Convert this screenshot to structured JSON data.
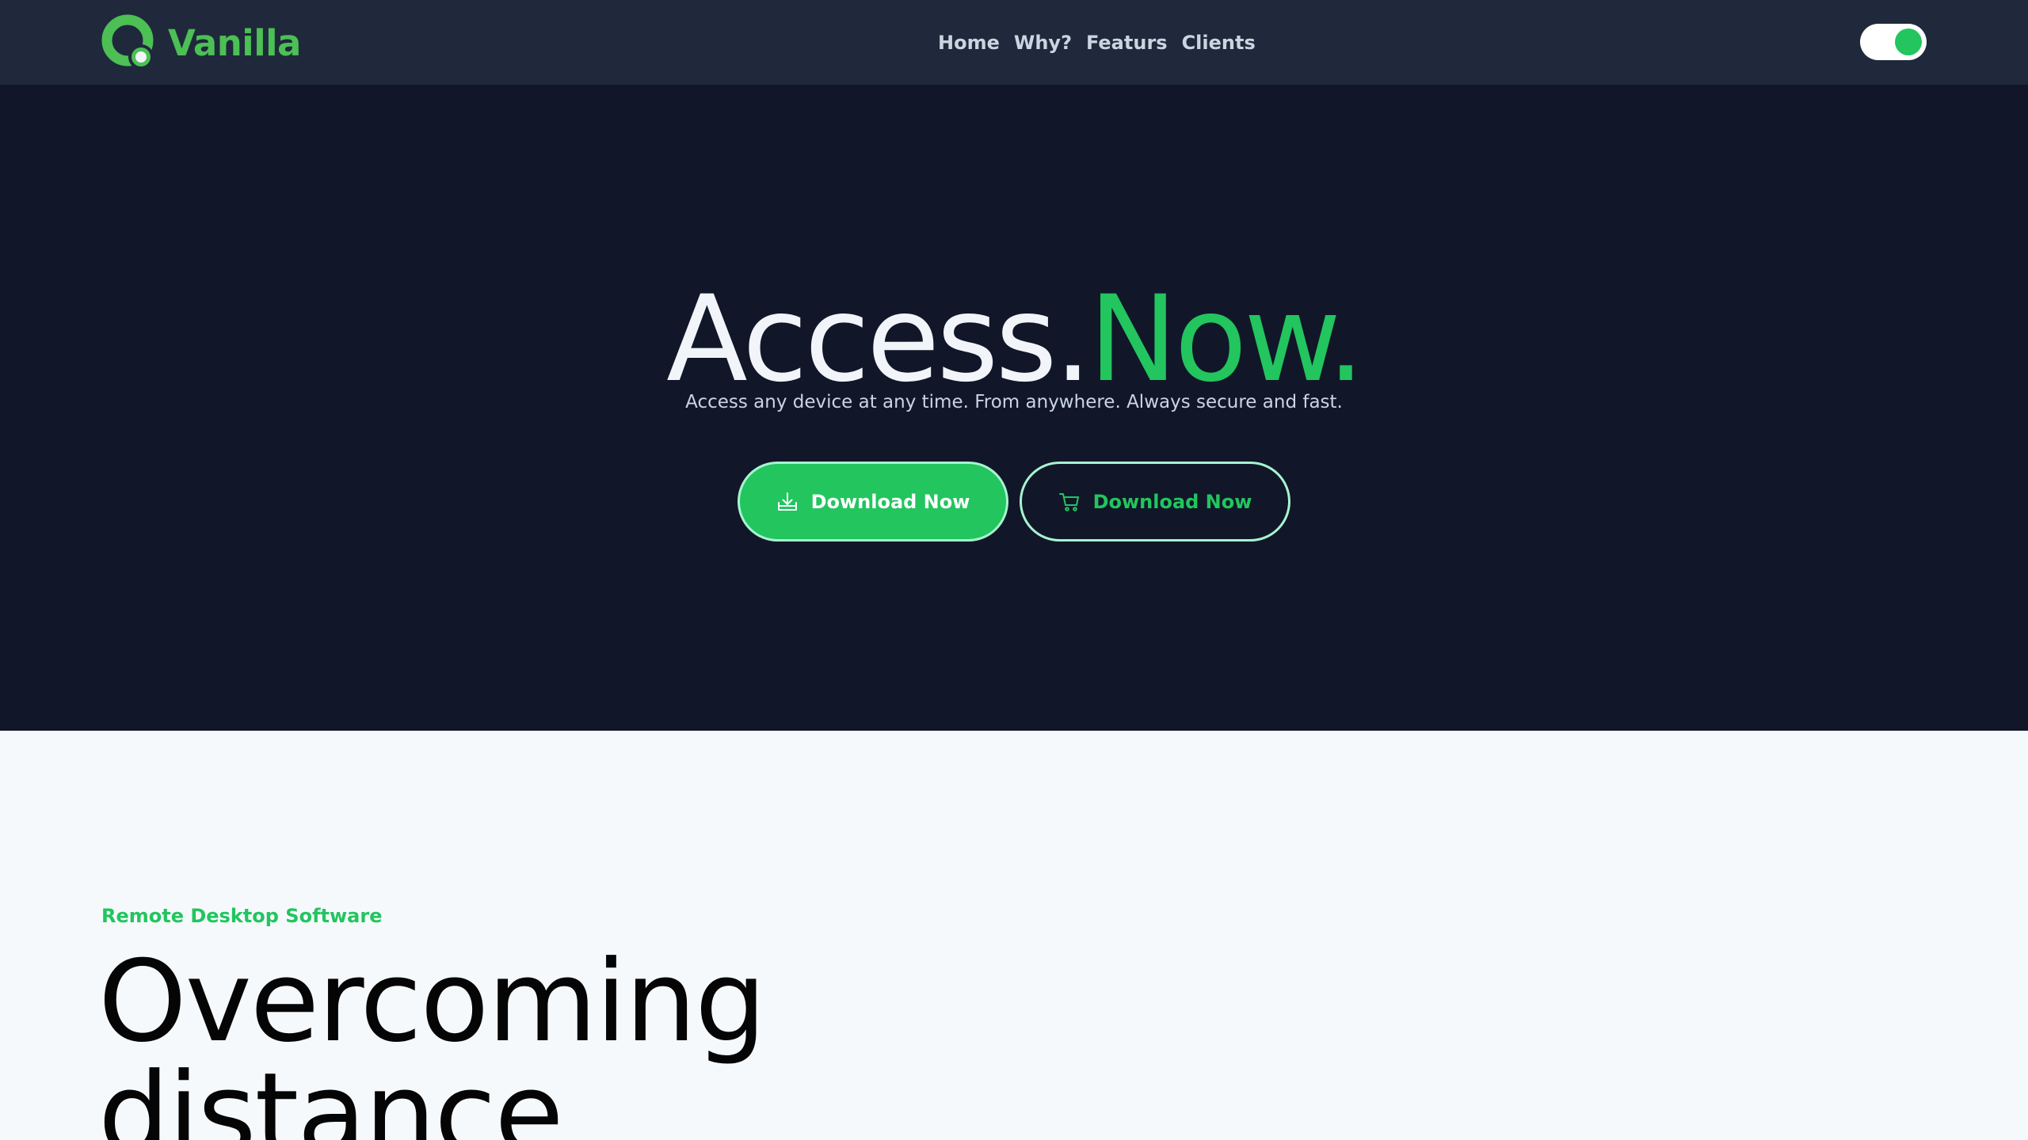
{
  "nav": {
    "logo_text": "Vanilla",
    "links": [
      "Home",
      "Why?",
      "Featurs",
      "Clients"
    ],
    "theme_toggle": {
      "state": "on",
      "accent": "#22c55e"
    }
  },
  "hero": {
    "title_part1": "Access.",
    "title_part2": "Now.",
    "subtitle": "Access any device at any time. From anywhere. Always secure and fast.",
    "primary_button": {
      "label": "Download Now",
      "icon": "download-icon"
    },
    "secondary_button": {
      "label": "Download Now",
      "icon": "cart-icon"
    }
  },
  "section": {
    "eyebrow": "Remote Desktop Software",
    "title": "Overcoming distance"
  },
  "colors": {
    "accent": "#22c55e",
    "logo": "#4cbf55",
    "navbar_bg": "#1f293b",
    "hero_bg": "#111729",
    "section_bg": "#f5f9fc"
  }
}
